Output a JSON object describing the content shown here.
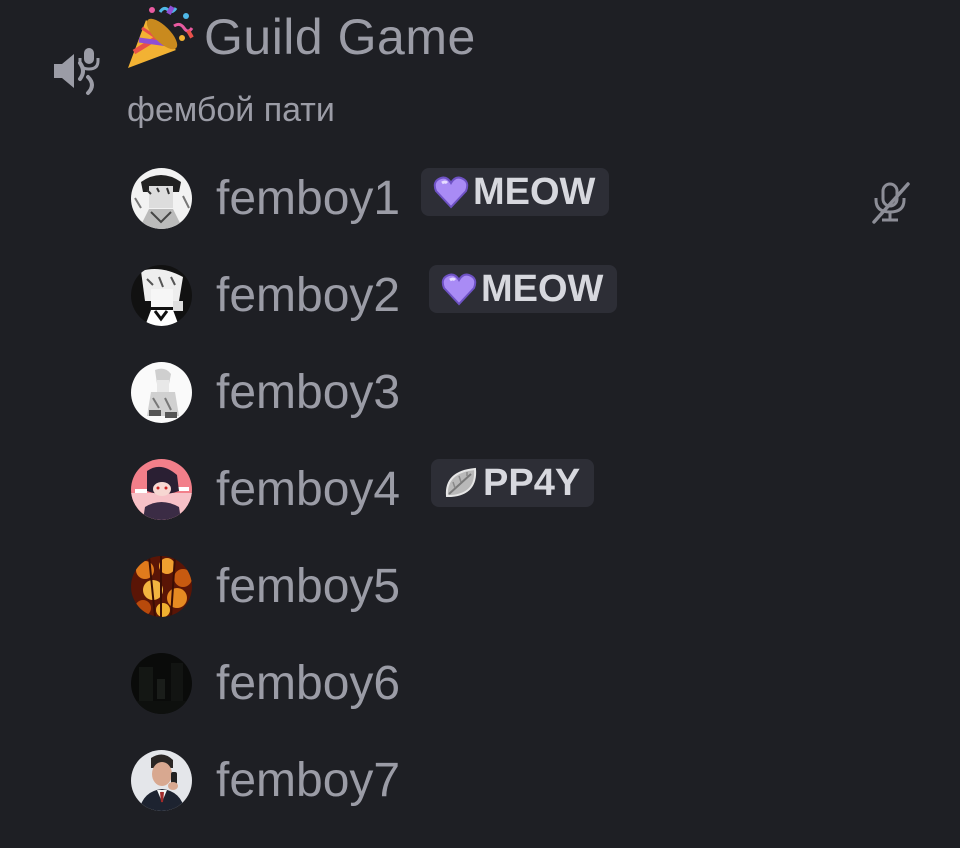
{
  "voice_channel": {
    "speaker_icon": "speaker-icon",
    "emoji": "party-popper",
    "name": "Guild Game",
    "status": "фембой пати"
  },
  "members": [
    {
      "name": "femboy1",
      "tag": "MEOW",
      "tag_icon": "purple-heart-icon",
      "muted": true
    },
    {
      "name": "femboy2",
      "tag": "MEOW",
      "tag_icon": "purple-heart-icon",
      "muted": false
    },
    {
      "name": "femboy3",
      "tag": null,
      "muted": false
    },
    {
      "name": "femboy4",
      "tag": "PP4Y",
      "tag_icon": "leaf-icon",
      "muted": false
    },
    {
      "name": "femboy5",
      "tag": null,
      "muted": false
    },
    {
      "name": "femboy6",
      "tag": null,
      "muted": false
    },
    {
      "name": "femboy7",
      "tag": null,
      "muted": false
    }
  ],
  "colors": {
    "background": "#1e1f24",
    "text_muted": "#9b9ca6",
    "tag_background": "#2d2e36",
    "tag_text": "#d7d8de",
    "heart": "#a98bf5"
  }
}
